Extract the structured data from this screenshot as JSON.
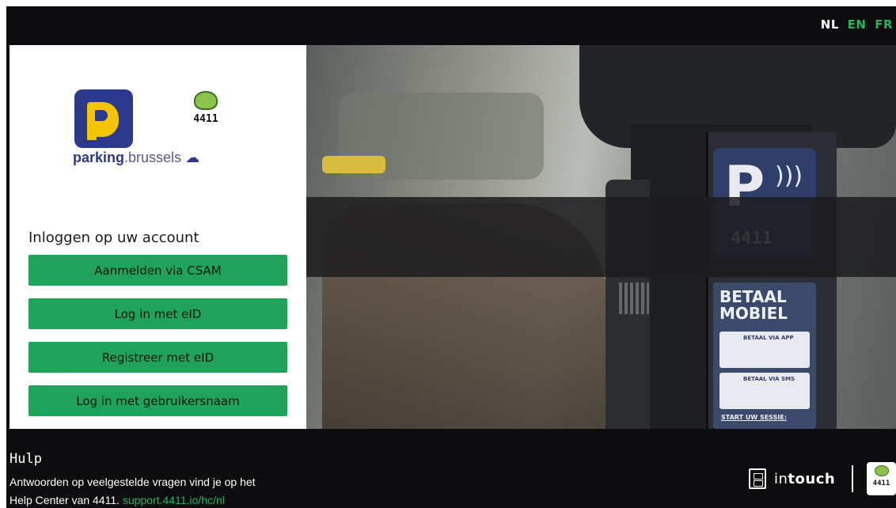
{
  "languages": [
    {
      "code": "NL",
      "active": true
    },
    {
      "code": "EN",
      "active": false
    },
    {
      "code": "FR",
      "active": false
    }
  ],
  "logos": {
    "parking_brand_bold": "parking",
    "parking_brand_light": ".brussels",
    "app_number": "4411"
  },
  "login": {
    "title": "Inloggen op uw account",
    "buttons": [
      "Aanmelden via CSAM",
      "Log in met eID",
      "Registreer met eID",
      "Log in met gebruikersnaam"
    ]
  },
  "help": {
    "title": "Hulp",
    "line1": "Antwoorden op veelgestelde vragen vind je op het",
    "line2_prefix": "Help Center van 4411. ",
    "link": "support.4411.io/hc/nl"
  },
  "footer": {
    "intouch_light": "in",
    "intouch_bold": "touch",
    "badge_number": "4411"
  },
  "colors": {
    "background": "#0d0d0f",
    "accent_green": "#1fa35a",
    "brand_blue": "#2b3a8c",
    "brand_yellow": "#f5c400"
  }
}
